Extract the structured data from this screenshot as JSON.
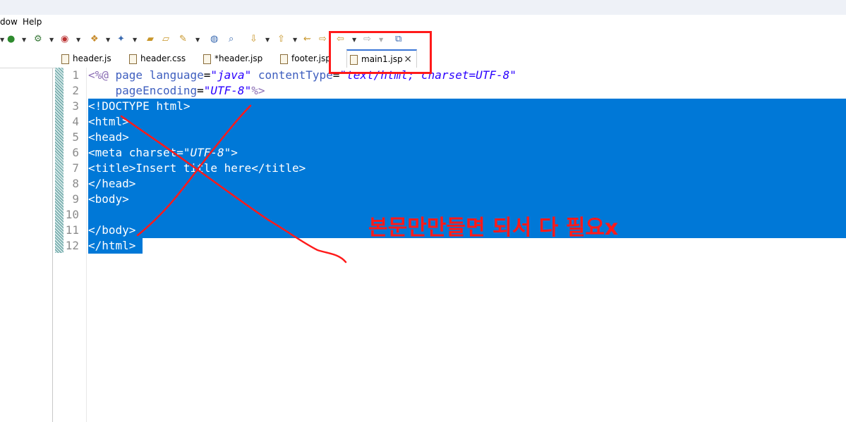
{
  "menu": {
    "items": [
      "dow",
      "Help"
    ]
  },
  "toolbar": {
    "icons": [
      "run-icon",
      "debug-icon",
      "coverage-icon",
      "new-icon",
      "wizard-icon",
      "open-folder-icon",
      "open-type-icon",
      "web-browser-icon",
      "search-icon",
      "next-annotation-icon",
      "prev-annotation-icon",
      "last-edit-icon",
      "forward-edit-icon",
      "back-icon",
      "forward-icon",
      "open-external-icon"
    ]
  },
  "tabs": [
    {
      "label": "header.js"
    },
    {
      "label": "header.css"
    },
    {
      "label": "*header.jsp"
    },
    {
      "label": "footer.jsp"
    },
    {
      "label": "main1.jsp",
      "active": true
    }
  ],
  "editor": {
    "line_numbers": [
      "1",
      "2",
      "3",
      "4",
      "5",
      "6",
      "7",
      "8",
      "9",
      "10",
      "11",
      "12"
    ],
    "fold_markers": [
      "⊖",
      "⊖",
      "⊖"
    ],
    "lines": {
      "l1a": "<%@ ",
      "l1b": "page ",
      "l1c": "language",
      "l1d": "=",
      "l1e": "\"java\"",
      "l1f": " contentType",
      "l1g": "=",
      "l1h": "\"text/html; charset=UTF-8\"",
      "l2a": "    pageEncoding",
      "l2b": "=",
      "l2c": "\"UTF-8\"",
      "l2d": "%>",
      "l3": "<!DOCTYPE html>",
      "l4": "<html>",
      "l5": "<head>",
      "l6a": "<meta charset=",
      "l6b": "\"UTF-8\"",
      "l6c": ">",
      "l7": "<title>Insert title here</title>",
      "l8": "</head>",
      "l9": "<body>",
      "l10": "",
      "l11": "</body>",
      "l12": "</html>"
    }
  },
  "annotation": {
    "text": "본문만만들면 되서 다 필요x",
    "color": "#ff1a1a"
  },
  "colors": {
    "selection": "#0078d7",
    "annotation": "#ff1a1a"
  }
}
